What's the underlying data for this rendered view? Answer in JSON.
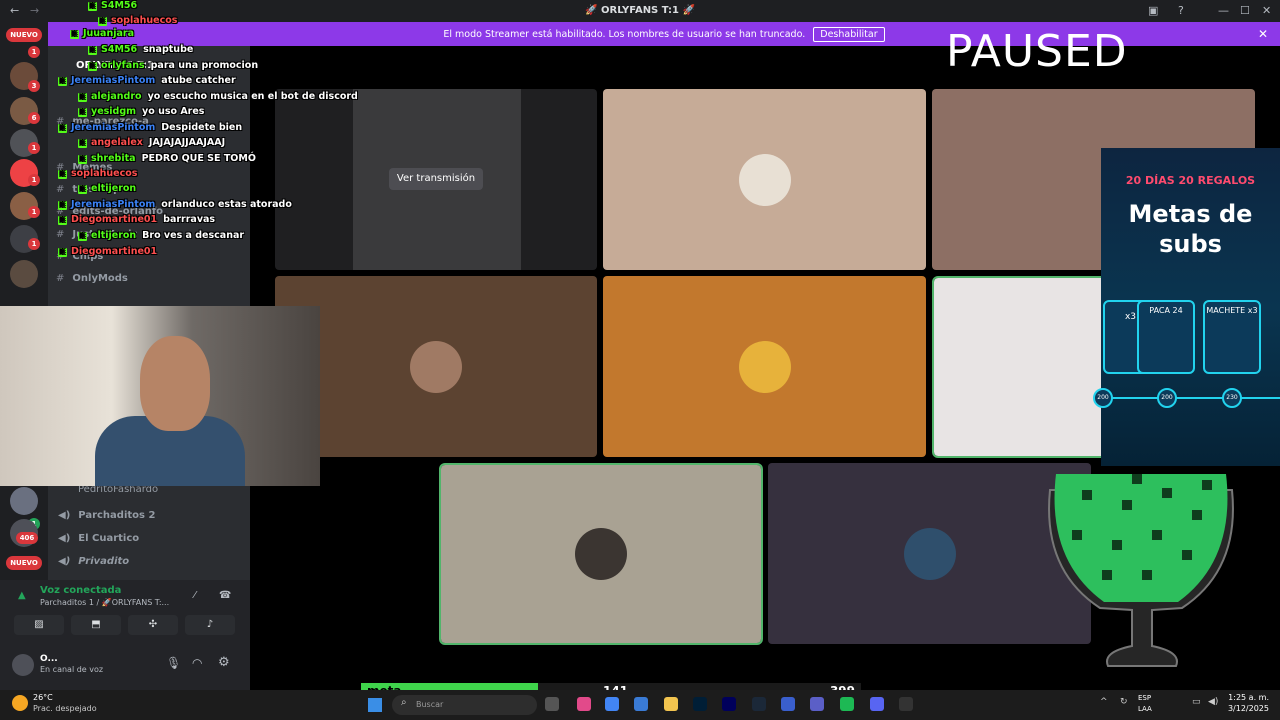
{
  "titlebar": {
    "title": "🚀 ORLYFANS T:1 🚀"
  },
  "banner": {
    "message": "El modo Streamer está habilitado. Los nombres de usuario se han truncado.",
    "button": "Deshabilitar"
  },
  "overlay": {
    "paused": "PAUSED"
  },
  "rail": {
    "nuevo_top": "NUEVO",
    "nuevo_bottom": "NUEVO",
    "badges": [
      "1",
      "3",
      "6",
      "1",
      "1",
      "1",
      "1",
      "1",
      "406"
    ]
  },
  "channels": {
    "server_title": "ORLYFANS T:1",
    "text_items": [
      "me-parezco-a",
      "Memes",
      "tu-setup",
      "edits-de-orlanfo",
      "Just - Music",
      "Chips",
      "OnlyMods"
    ],
    "voice_items": [
      "Parchaditos 2",
      "El Cuartico",
      "Privadito"
    ],
    "voice_member": "PedritoFashardo"
  },
  "chat": [
    {
      "user": "S4M56",
      "msg": "",
      "color": "#53fc18"
    },
    {
      "user": "soplahuecos",
      "msg": "",
      "color": "#ff4f4f"
    },
    {
      "user": "Juuanjara",
      "msg": "",
      "color": "#53fc18"
    },
    {
      "user": "S4M56",
      "msg": "snaptube",
      "color": "#53fc18"
    },
    {
      "user": "orlyfans",
      "msg": "para una promocion",
      "color": "#53fc18"
    },
    {
      "user": "JeremiasPintom",
      "msg": "atube catcher",
      "color": "#3b82f6"
    },
    {
      "user": "alejandro",
      "msg": "yo escucho musica en el bot de discord",
      "color": "#53fc18"
    },
    {
      "user": "yesidgm",
      "msg": "yo uso Ares",
      "color": "#53fc18"
    },
    {
      "user": "JeremiasPintom",
      "msg": "Despidete bien",
      "color": "#3b82f6"
    },
    {
      "user": "angelalex",
      "msg": "JAJAJAJJAAJAAJ",
      "color": "#ff4f4f"
    },
    {
      "user": "shrebita",
      "msg": "PEDRO QUE SE TOMÓ",
      "color": "#53fc18"
    },
    {
      "user": "soplahuecos",
      "msg": "",
      "color": "#ff4f4f"
    },
    {
      "user": "eltijeron",
      "msg": "",
      "color": "#53fc18"
    },
    {
      "user": "JeremiasPintom",
      "msg": "orlanduco estas atorado",
      "color": "#3b82f6"
    },
    {
      "user": "Diegomartine01",
      "msg": "barrravas",
      "color": "#ff4f4f"
    },
    {
      "user": "eltijeron",
      "msg": "Bro ves a descanar",
      "color": "#53fc18"
    },
    {
      "user": "Diegomartine01",
      "msg": "",
      "color": "#ff4f4f"
    }
  ],
  "stage": {
    "watch_button": "Ver transmisión"
  },
  "voice_panel": {
    "status": "Voz conectada",
    "channel": "Parchaditos 1 / 🚀ORLYFANS T:...",
    "user": "O...",
    "user_status": "En canal de voz"
  },
  "promo": {
    "days": "20 DÍAS 20 REGALOS",
    "title_1": "Metas de",
    "title_2": "subs",
    "card_1": "x3",
    "card_2": "PACA 24",
    "card_3": "MACHETE x3",
    "milestones": [
      "200",
      "200",
      "230"
    ]
  },
  "goal_bar": {
    "label": "meta",
    "current": "141",
    "goal": "399",
    "progress": 0.353
  },
  "taskbar": {
    "weather_temp": "26°C",
    "weather_desc": "Prac. despejado",
    "search": "Buscar",
    "lang_1": "ESP",
    "lang_2": "LAA",
    "time": "1:25 a. m.",
    "date": "3/12/2025"
  },
  "colors": {
    "discord_dark": "#1e1f22",
    "sidebar": "#2b2d31",
    "streamer_banner": "#8d39e8",
    "kick_green": "#53fc18",
    "voice_green": "#23a55a",
    "meta_fill": "#3fd44b"
  }
}
